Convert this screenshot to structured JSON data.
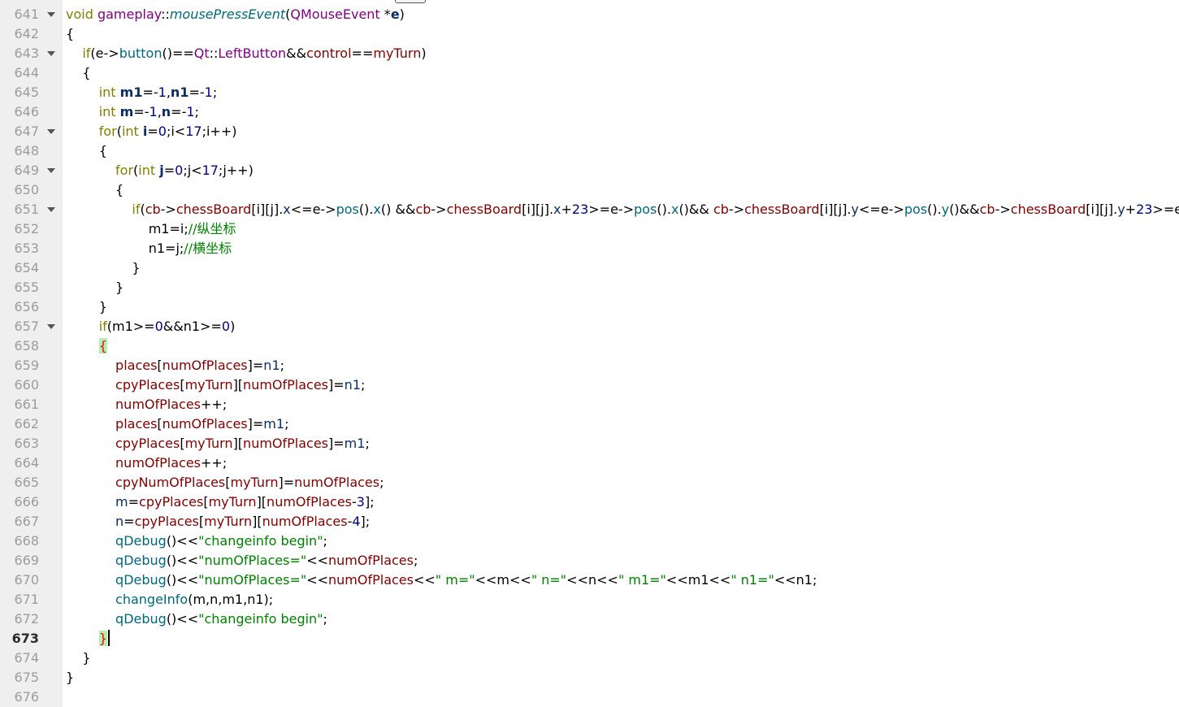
{
  "editor": {
    "current_line": "673",
    "lines": [
      {
        "n": "641",
        "fold": true,
        "tokens": [
          [
            "kw",
            "void "
          ],
          [
            "type",
            "gameplay"
          ],
          [
            "op",
            "::"
          ],
          [
            "fnd",
            "mousePressEvent"
          ],
          [
            "op",
            "("
          ],
          [
            "type",
            "QMouseEvent"
          ],
          [
            "op",
            " *"
          ],
          [
            "lv",
            "e"
          ],
          [
            "op",
            ")"
          ]
        ]
      },
      {
        "n": "642",
        "tokens": [
          [
            "op",
            "{"
          ]
        ]
      },
      {
        "n": "643",
        "fold": true,
        "tokens": [
          [
            "op",
            "    "
          ],
          [
            "kw",
            "if"
          ],
          [
            "op",
            "(e->"
          ],
          [
            "fn",
            "button"
          ],
          [
            "op",
            "()=="
          ],
          [
            "type",
            "Qt"
          ],
          [
            "op",
            "::"
          ],
          [
            "type",
            "LeftButton"
          ],
          [
            "op",
            "&&"
          ],
          [
            "mem",
            "control"
          ],
          [
            "op",
            "=="
          ],
          [
            "mem",
            "myTurn"
          ],
          [
            "op",
            ")"
          ]
        ]
      },
      {
        "n": "644",
        "tokens": [
          [
            "op",
            "    {"
          ]
        ]
      },
      {
        "n": "645",
        "tokens": [
          [
            "op",
            "        "
          ],
          [
            "kw",
            "int "
          ],
          [
            "lv",
            "m1"
          ],
          [
            "op",
            "=-"
          ],
          [
            "num",
            "1"
          ],
          [
            "op",
            ","
          ],
          [
            "lv",
            "n1"
          ],
          [
            "op",
            "=-"
          ],
          [
            "num",
            "1"
          ],
          [
            "op",
            ";"
          ]
        ]
      },
      {
        "n": "646",
        "tokens": [
          [
            "op",
            "        "
          ],
          [
            "kw",
            "int "
          ],
          [
            "lv",
            "m"
          ],
          [
            "op",
            "=-"
          ],
          [
            "num",
            "1"
          ],
          [
            "op",
            ","
          ],
          [
            "lv",
            "n"
          ],
          [
            "op",
            "=-"
          ],
          [
            "num",
            "1"
          ],
          [
            "op",
            ";"
          ]
        ]
      },
      {
        "n": "647",
        "fold": true,
        "tokens": [
          [
            "op",
            "        "
          ],
          [
            "kw",
            "for"
          ],
          [
            "op",
            "("
          ],
          [
            "kw",
            "int "
          ],
          [
            "lv",
            "i"
          ],
          [
            "op",
            "="
          ],
          [
            "num",
            "0"
          ],
          [
            "op",
            ";i<"
          ],
          [
            "num",
            "17"
          ],
          [
            "op",
            ";i++)"
          ]
        ]
      },
      {
        "n": "648",
        "tokens": [
          [
            "op",
            "        {"
          ]
        ]
      },
      {
        "n": "649",
        "fold": true,
        "tokens": [
          [
            "op",
            "            "
          ],
          [
            "kw",
            "for"
          ],
          [
            "op",
            "("
          ],
          [
            "kw",
            "int "
          ],
          [
            "lv",
            "j"
          ],
          [
            "op",
            "="
          ],
          [
            "num",
            "0"
          ],
          [
            "op",
            ";j<"
          ],
          [
            "num",
            "17"
          ],
          [
            "op",
            ";j++)"
          ]
        ]
      },
      {
        "n": "650",
        "tokens": [
          [
            "op",
            "            {"
          ]
        ]
      },
      {
        "n": "651",
        "fold": true,
        "tokens": [
          [
            "op",
            "                "
          ],
          [
            "kw",
            "if"
          ],
          [
            "op",
            "("
          ],
          [
            "mem",
            "cb"
          ],
          [
            "op",
            "->"
          ],
          [
            "mem",
            "chessBoard"
          ],
          [
            "op",
            "[i][j]."
          ],
          [
            "var",
            "x"
          ],
          [
            "op",
            "<=e->"
          ],
          [
            "fn",
            "pos"
          ],
          [
            "op",
            "()."
          ],
          [
            "fn",
            "x"
          ],
          [
            "op",
            "() &&"
          ],
          [
            "mem",
            "cb"
          ],
          [
            "op",
            "->"
          ],
          [
            "mem",
            "chessBoard"
          ],
          [
            "op",
            "[i][j]."
          ],
          [
            "var",
            "x"
          ],
          [
            "op",
            "+"
          ],
          [
            "num",
            "23"
          ],
          [
            "op",
            ">=e->"
          ],
          [
            "fn",
            "pos"
          ],
          [
            "op",
            "()."
          ],
          [
            "fn",
            "x"
          ],
          [
            "op",
            "()&& "
          ],
          [
            "mem",
            "cb"
          ],
          [
            "op",
            "->"
          ],
          [
            "mem",
            "chessBoard"
          ],
          [
            "op",
            "[i][j]."
          ],
          [
            "var",
            "y"
          ],
          [
            "op",
            "<=e->"
          ],
          [
            "fn",
            "pos"
          ],
          [
            "op",
            "()."
          ],
          [
            "fn",
            "y"
          ],
          [
            "op",
            "()&&"
          ],
          [
            "mem",
            "cb"
          ],
          [
            "op",
            "->"
          ],
          [
            "mem",
            "chessBoard"
          ],
          [
            "op",
            "[i][j]."
          ],
          [
            "var",
            "y"
          ],
          [
            "op",
            "+"
          ],
          [
            "num",
            "23"
          ],
          [
            "op",
            ">=e->"
          ],
          [
            "fn",
            "pos"
          ],
          [
            "op",
            "()."
          ],
          [
            "fn",
            "y"
          ],
          [
            "op",
            "()){"
          ]
        ]
      },
      {
        "n": "652",
        "tokens": [
          [
            "op",
            "                    m1=i;"
          ],
          [
            "cmt",
            "//纵坐标"
          ]
        ]
      },
      {
        "n": "653",
        "tokens": [
          [
            "op",
            "                    n1=j;"
          ],
          [
            "cmt",
            "//横坐标"
          ]
        ]
      },
      {
        "n": "654",
        "tokens": [
          [
            "op",
            "                }"
          ]
        ]
      },
      {
        "n": "655",
        "tokens": [
          [
            "op",
            "            }"
          ]
        ]
      },
      {
        "n": "656",
        "tokens": [
          [
            "op",
            "        }"
          ]
        ]
      },
      {
        "n": "657",
        "fold": true,
        "tokens": [
          [
            "op",
            "        "
          ],
          [
            "kw",
            "if"
          ],
          [
            "op",
            "(m1>="
          ],
          [
            "num",
            "0"
          ],
          [
            "op",
            "&&n1>="
          ],
          [
            "num",
            "0"
          ],
          [
            "op",
            ")"
          ]
        ]
      },
      {
        "n": "658",
        "tokens": [
          [
            "op",
            "        "
          ],
          [
            "brace",
            "{"
          ]
        ]
      },
      {
        "n": "659",
        "tokens": [
          [
            "op",
            "            "
          ],
          [
            "mem",
            "places"
          ],
          [
            "op",
            "["
          ],
          [
            "mem",
            "numOfPlaces"
          ],
          [
            "op",
            "]="
          ],
          [
            "var",
            "n1"
          ],
          [
            "op",
            ";"
          ]
        ]
      },
      {
        "n": "660",
        "tokens": [
          [
            "op",
            "            "
          ],
          [
            "mem",
            "cpyPlaces"
          ],
          [
            "op",
            "["
          ],
          [
            "mem",
            "myTurn"
          ],
          [
            "op",
            "]["
          ],
          [
            "mem",
            "numOfPlaces"
          ],
          [
            "op",
            "]="
          ],
          [
            "var",
            "n1"
          ],
          [
            "op",
            ";"
          ]
        ]
      },
      {
        "n": "661",
        "tokens": [
          [
            "op",
            "            "
          ],
          [
            "mem",
            "numOfPlaces"
          ],
          [
            "op",
            "++;"
          ]
        ]
      },
      {
        "n": "662",
        "tokens": [
          [
            "op",
            "            "
          ],
          [
            "mem",
            "places"
          ],
          [
            "op",
            "["
          ],
          [
            "mem",
            "numOfPlaces"
          ],
          [
            "op",
            "]="
          ],
          [
            "var",
            "m1"
          ],
          [
            "op",
            ";"
          ]
        ]
      },
      {
        "n": "663",
        "tokens": [
          [
            "op",
            "            "
          ],
          [
            "mem",
            "cpyPlaces"
          ],
          [
            "op",
            "["
          ],
          [
            "mem",
            "myTurn"
          ],
          [
            "op",
            "]["
          ],
          [
            "mem",
            "numOfPlaces"
          ],
          [
            "op",
            "]="
          ],
          [
            "var",
            "m1"
          ],
          [
            "op",
            ";"
          ]
        ]
      },
      {
        "n": "664",
        "tokens": [
          [
            "op",
            "            "
          ],
          [
            "mem",
            "numOfPlaces"
          ],
          [
            "op",
            "++;"
          ]
        ]
      },
      {
        "n": "665",
        "tokens": [
          [
            "op",
            "            "
          ],
          [
            "mem",
            "cpyNumOfPlaces"
          ],
          [
            "op",
            "["
          ],
          [
            "mem",
            "myTurn"
          ],
          [
            "op",
            "]="
          ],
          [
            "mem",
            "numOfPlaces"
          ],
          [
            "op",
            ";"
          ]
        ]
      },
      {
        "n": "666",
        "tokens": [
          [
            "op",
            "            "
          ],
          [
            "var",
            "m"
          ],
          [
            "op",
            "="
          ],
          [
            "mem",
            "cpyPlaces"
          ],
          [
            "op",
            "["
          ],
          [
            "mem",
            "myTurn"
          ],
          [
            "op",
            "]["
          ],
          [
            "mem",
            "numOfPlaces"
          ],
          [
            "op",
            "-"
          ],
          [
            "num",
            "3"
          ],
          [
            "op",
            "];"
          ]
        ]
      },
      {
        "n": "667",
        "tokens": [
          [
            "op",
            "            "
          ],
          [
            "var",
            "n"
          ],
          [
            "op",
            "="
          ],
          [
            "mem",
            "cpyPlaces"
          ],
          [
            "op",
            "["
          ],
          [
            "mem",
            "myTurn"
          ],
          [
            "op",
            "]["
          ],
          [
            "mem",
            "numOfPlaces"
          ],
          [
            "op",
            "-"
          ],
          [
            "num",
            "4"
          ],
          [
            "op",
            "];"
          ]
        ]
      },
      {
        "n": "668",
        "tokens": [
          [
            "op",
            "            "
          ],
          [
            "fn",
            "qDebug"
          ],
          [
            "op",
            "()<<"
          ],
          [
            "str",
            "\"changeinfo begin\""
          ],
          [
            "op",
            ";"
          ]
        ]
      },
      {
        "n": "669",
        "tokens": [
          [
            "op",
            "            "
          ],
          [
            "fn",
            "qDebug"
          ],
          [
            "op",
            "()<<"
          ],
          [
            "str",
            "\"numOfPlaces=\""
          ],
          [
            "op",
            "<<"
          ],
          [
            "mem",
            "numOfPlaces"
          ],
          [
            "op",
            ";"
          ]
        ]
      },
      {
        "n": "670",
        "tokens": [
          [
            "op",
            "            "
          ],
          [
            "fn",
            "qDebug"
          ],
          [
            "op",
            "()<<"
          ],
          [
            "str",
            "\"numOfPlaces=\""
          ],
          [
            "op",
            "<<"
          ],
          [
            "mem",
            "numOfPlaces"
          ],
          [
            "op",
            "<<"
          ],
          [
            "str",
            "\" m=\""
          ],
          [
            "op",
            "<<m<<"
          ],
          [
            "str",
            "\" n=\""
          ],
          [
            "op",
            "<<n<<"
          ],
          [
            "str",
            "\" m1=\""
          ],
          [
            "op",
            "<<m1<<"
          ],
          [
            "str",
            "\" n1=\""
          ],
          [
            "op",
            "<<n1;"
          ]
        ]
      },
      {
        "n": "671",
        "tokens": [
          [
            "op",
            "            "
          ],
          [
            "fn",
            "changeInfo"
          ],
          [
            "op",
            "(m,n,m1,n1);"
          ]
        ]
      },
      {
        "n": "672",
        "tokens": [
          [
            "op",
            "            "
          ],
          [
            "fn",
            "qDebug"
          ],
          [
            "op",
            "()<<"
          ],
          [
            "str",
            "\"changeinfo begin\""
          ],
          [
            "op",
            ";"
          ]
        ]
      },
      {
        "n": "673",
        "caret": true,
        "tokens": [
          [
            "op",
            "        "
          ],
          [
            "brace",
            "}"
          ]
        ]
      },
      {
        "n": "674",
        "tokens": [
          [
            "op",
            "    }"
          ]
        ]
      },
      {
        "n": "675",
        "tokens": [
          [
            "op",
            "}"
          ]
        ]
      },
      {
        "n": "676",
        "tokens": []
      }
    ]
  }
}
